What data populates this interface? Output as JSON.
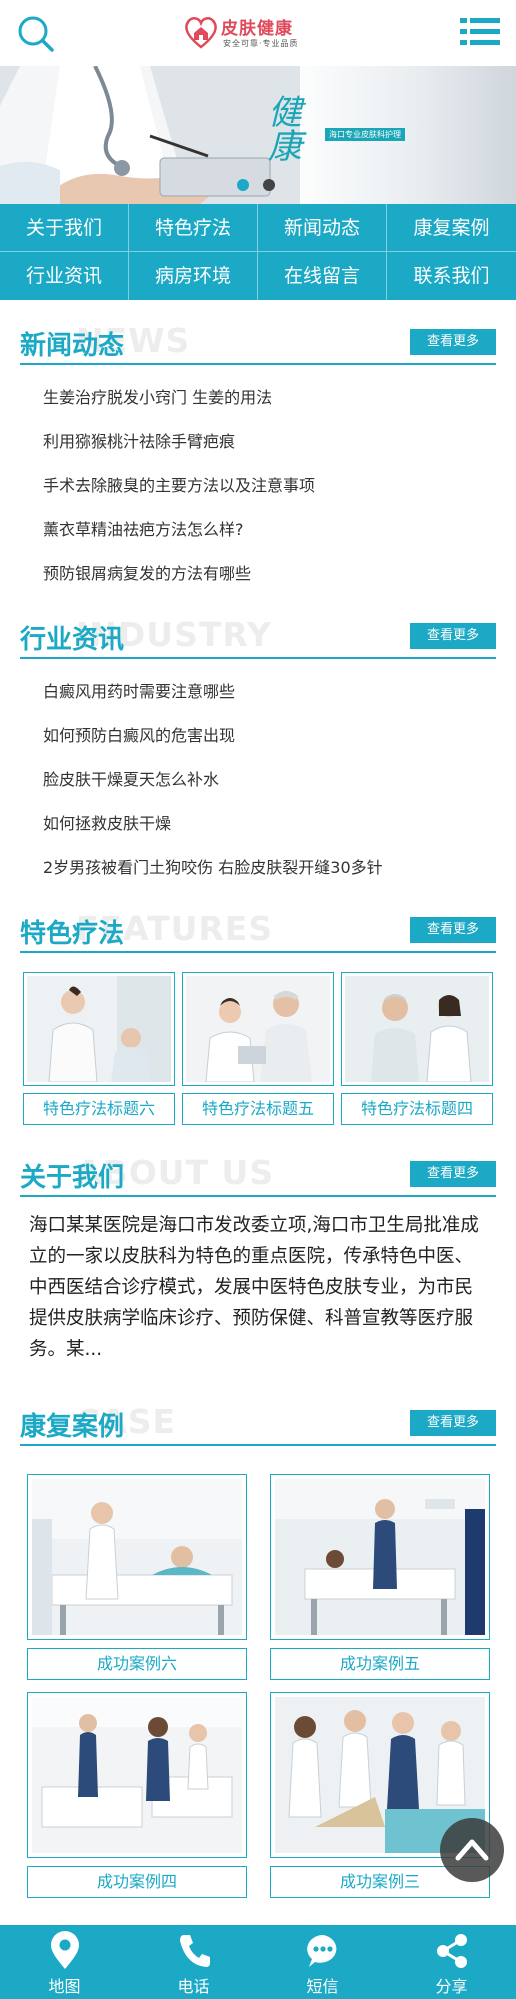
{
  "brand": {
    "name": "皮肤健康",
    "slogan": "安全可靠·专业品质",
    "accent": "#1ba9c6",
    "logo_red": "#e04a5a"
  },
  "banner": {
    "calligraphy": "健康",
    "tag": "海口专业皮肤科护理",
    "slide_count": 2,
    "active_slide": 1
  },
  "nav": {
    "items": [
      {
        "label": "关于我们"
      },
      {
        "label": "特色疗法"
      },
      {
        "label": "新闻动态"
      },
      {
        "label": "康复案例"
      },
      {
        "label": "行业资讯"
      },
      {
        "label": "病房环境"
      },
      {
        "label": "在线留言"
      },
      {
        "label": "联系我们"
      }
    ]
  },
  "news": {
    "title": "新闻动态",
    "bg_text": "NEWS",
    "more": "查看更多",
    "items": [
      "生姜治疗脱发小窍门 生姜的用法",
      "利用猕猴桃汁祛除手臂疤痕",
      "手术去除腋臭的主要方法以及注意事项",
      "薰衣草精油祛疤方法怎么样?",
      "预防银屑病复发的方法有哪些"
    ]
  },
  "industry": {
    "title": "行业资讯",
    "bg_text": "INDUSTRY",
    "more": "查看更多",
    "items": [
      "白癜风用药时需要注意哪些",
      "如何预防白癜风的危害出现",
      "脸皮肤干燥夏天怎么补水",
      "如何拯救皮肤干燥",
      "2岁男孩被看门土狗咬伤 右脸皮肤裂开缝30多针"
    ]
  },
  "features": {
    "title": "特色疗法",
    "bg_text": "FEATURES",
    "more": "查看更多",
    "items": [
      {
        "caption": "特色疗法标题六"
      },
      {
        "caption": "特色疗法标题五"
      },
      {
        "caption": "特色疗法标题四"
      }
    ]
  },
  "about": {
    "title": "关于我们",
    "bg_text": "ABOUT US",
    "more": "查看更多",
    "text": "海口某某医院是海口市发改委立项,海口市卫生局批准成立的一家以皮肤科为特色的重点医院，传承特色中医、中西医结合诊疗模式，发展中医特色皮肤专业，为市民提供皮肤病学临床诊疗、预防保健、科普宣教等医疗服务。某..."
  },
  "cases": {
    "title": "康复案例",
    "bg_text": "CASE",
    "more": "查看更多",
    "items": [
      {
        "caption": "成功案例六"
      },
      {
        "caption": "成功案例五"
      },
      {
        "caption": "成功案例四"
      },
      {
        "caption": "成功案例三"
      }
    ]
  },
  "footer": {
    "items": [
      {
        "label": "地图",
        "icon": "map-pin-icon"
      },
      {
        "label": "电话",
        "icon": "phone-icon"
      },
      {
        "label": "短信",
        "icon": "message-icon"
      },
      {
        "label": "分享",
        "icon": "share-icon"
      }
    ]
  }
}
